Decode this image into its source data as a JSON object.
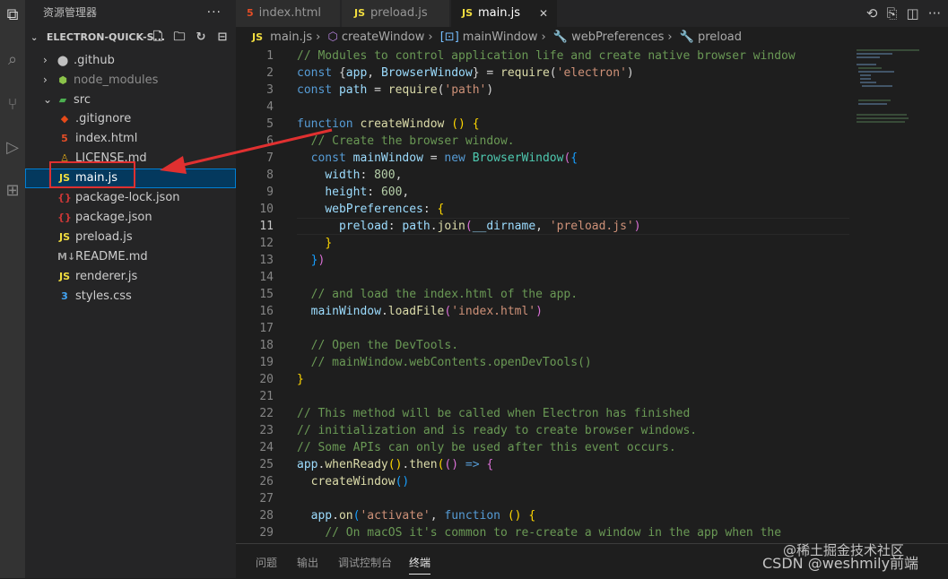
{
  "sidebar": {
    "header_title": "资源管理器",
    "more": "···",
    "section_title": "ELECTRON-QUICK-S...",
    "items": [
      {
        "label": ".github",
        "icon": "github-folder-icon",
        "chevron": "›",
        "color": "#cccccc"
      },
      {
        "label": "node_modules",
        "icon": "node-folder-icon",
        "chevron": "›",
        "color": "#8c8c8c"
      },
      {
        "label": "src",
        "icon": "src-folder-icon",
        "chevron": "⌄",
        "color": "#cccccc"
      },
      {
        "label": ".gitignore",
        "icon": "git-icon",
        "chevron": "",
        "color": "#cccccc"
      },
      {
        "label": "index.html",
        "icon": "html-icon",
        "chevron": "",
        "color": "#cccccc"
      },
      {
        "label": "LICENSE.md",
        "icon": "license-icon",
        "chevron": "",
        "color": "#cccccc"
      },
      {
        "label": "main.js",
        "icon": "js-icon",
        "chevron": "",
        "color": "#ffffff",
        "selected": true
      },
      {
        "label": "package-lock.json",
        "icon": "json-icon",
        "chevron": "",
        "color": "#cccccc"
      },
      {
        "label": "package.json",
        "icon": "json-icon",
        "chevron": "",
        "color": "#cccccc"
      },
      {
        "label": "preload.js",
        "icon": "js-icon",
        "chevron": "",
        "color": "#cccccc"
      },
      {
        "label": "README.md",
        "icon": "markdown-icon",
        "chevron": "",
        "color": "#cccccc"
      },
      {
        "label": "renderer.js",
        "icon": "js-icon",
        "chevron": "",
        "color": "#cccccc"
      },
      {
        "label": "styles.css",
        "icon": "css-icon",
        "chevron": "",
        "color": "#cccccc"
      }
    ]
  },
  "tabs": [
    {
      "label": "index.html",
      "icon": "html-icon",
      "active": false
    },
    {
      "label": "preload.js",
      "icon": "js-icon",
      "active": false
    },
    {
      "label": "main.js",
      "icon": "js-icon",
      "active": true
    }
  ],
  "tab_close": "✕",
  "breadcrumb": [
    "main.js",
    "createWindow",
    "mainWindow",
    "webPreferences",
    "preload"
  ],
  "editor": {
    "current_line": 11,
    "lines": [
      {
        "n": 1,
        "html": "<span class='c'>// Modules to control application life and create native browser window</span>"
      },
      {
        "n": 2,
        "html": "<span class='k'>const</span> <span class='p'>{</span><span class='v'>app</span><span class='p'>, </span><span class='v'>BrowserWindow</span><span class='p'>} = </span><span class='f'>require</span><span class='p'>(</span><span class='s'>'electron'</span><span class='p'>)</span>"
      },
      {
        "n": 3,
        "html": "<span class='k'>const</span> <span class='v'>path</span> <span class='p'>= </span><span class='f'>require</span><span class='p'>(</span><span class='s'>'path'</span><span class='p'>)</span>"
      },
      {
        "n": 4,
        "html": ""
      },
      {
        "n": 5,
        "html": "<span class='k'>function</span> <span class='f'>createWindow</span> <span class='b'>()</span> <span class='b'>{</span>"
      },
      {
        "n": 6,
        "html": "  <span class='c'>// Create the browser window.</span>"
      },
      {
        "n": 7,
        "html": "  <span class='k'>const</span> <span class='v'>mainWindow</span> <span class='p'>= </span><span class='k'>new</span> <span class='t'>BrowserWindow</span><span class='b2'>(</span><span class='b3'>{</span>"
      },
      {
        "n": 8,
        "html": "    <span class='v'>width</span><span class='p'>: </span><span class='n'>800</span><span class='p'>,</span>"
      },
      {
        "n": 9,
        "html": "    <span class='v'>height</span><span class='p'>: </span><span class='n'>600</span><span class='p'>,</span>"
      },
      {
        "n": 10,
        "html": "    <span class='v'>webPreferences</span><span class='p'>: </span><span class='b'>{</span>"
      },
      {
        "n": 11,
        "html": "      <span class='v'>preload</span><span class='p'>: </span><span class='v'>path</span><span class='p'>.</span><span class='f'>join</span><span class='b2'>(</span><span class='v'>__dirname</span><span class='p'>, </span><span class='s'>'preload.js'</span><span class='b2'>)</span>"
      },
      {
        "n": 12,
        "html": "    <span class='b'>}</span>"
      },
      {
        "n": 13,
        "html": "  <span class='b3'>}</span><span class='b2'>)</span>"
      },
      {
        "n": 14,
        "html": ""
      },
      {
        "n": 15,
        "html": "  <span class='c'>// and load the index.html of the app.</span>"
      },
      {
        "n": 16,
        "html": "  <span class='v'>mainWindow</span><span class='p'>.</span><span class='f'>loadFile</span><span class='b2'>(</span><span class='s'>'index.html'</span><span class='b2'>)</span>"
      },
      {
        "n": 17,
        "html": ""
      },
      {
        "n": 18,
        "html": "  <span class='c'>// Open the DevTools.</span>"
      },
      {
        "n": 19,
        "html": "  <span class='c'>// mainWindow.webContents.openDevTools()</span>"
      },
      {
        "n": 20,
        "html": "<span class='b'>}</span>"
      },
      {
        "n": 21,
        "html": ""
      },
      {
        "n": 22,
        "html": "<span class='c'>// This method will be called when Electron has finished</span>"
      },
      {
        "n": 23,
        "html": "<span class='c'>// initialization and is ready to create browser windows.</span>"
      },
      {
        "n": 24,
        "html": "<span class='c'>// Some APIs can only be used after this event occurs.</span>"
      },
      {
        "n": 25,
        "html": "<span class='v'>app</span><span class='p'>.</span><span class='f'>whenReady</span><span class='b'>()</span><span class='p'>.</span><span class='f'>then</span><span class='b'>(</span><span class='b2'>()</span> <span class='k'>=&gt;</span> <span class='b2'>{</span>"
      },
      {
        "n": 26,
        "html": "  <span class='f'>createWindow</span><span class='b3'>()</span>"
      },
      {
        "n": 27,
        "html": ""
      },
      {
        "n": 28,
        "html": "  <span class='v'>app</span><span class='p'>.</span><span class='f'>on</span><span class='b3'>(</span><span class='s'>'activate'</span><span class='p'>, </span><span class='k'>function</span> <span class='b'>()</span> <span class='b'>{</span>"
      },
      {
        "n": 29,
        "html": "    <span class='c'>// On macOS it's common to re-create a window in the app when the</span>"
      }
    ]
  },
  "panel_tabs": [
    {
      "label": "问题",
      "active": false
    },
    {
      "label": "输出",
      "active": false
    },
    {
      "label": "调试控制台",
      "active": false
    },
    {
      "label": "终端",
      "active": true
    }
  ],
  "watermarks": {
    "juejin": "@稀土掘金技术社区",
    "csdn": "CSDN @weshmily前端"
  },
  "colors": {
    "selection_outline": "#007fd4",
    "highlight_box": "#e03030",
    "arrow": "#e03030"
  }
}
